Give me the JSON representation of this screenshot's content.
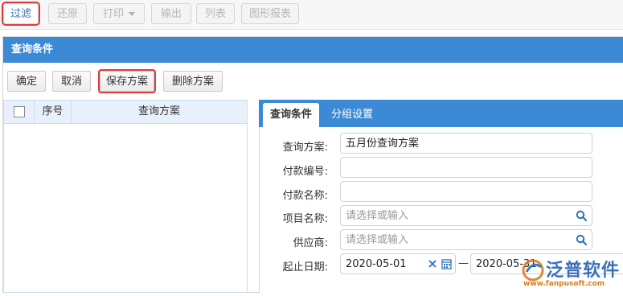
{
  "toolbar": {
    "filter": "过滤",
    "restore": "还原",
    "print": "打印",
    "export": "输出",
    "list": "列表",
    "chart_report": "图形报表"
  },
  "panel": {
    "title": "查询条件",
    "buttons": {
      "confirm": "确定",
      "cancel": "取消",
      "save_scheme": "保存方案",
      "delete_scheme": "删除方案"
    }
  },
  "grid": {
    "columns": [
      "序号",
      "查询方案"
    ]
  },
  "tabs": {
    "query": "查询条件",
    "group": "分组设置"
  },
  "form": {
    "scheme": {
      "label": "查询方案:",
      "value": "五月份查询方案"
    },
    "payment_no": {
      "label": "付款编号:",
      "value": ""
    },
    "payment_name": {
      "label": "付款名称:",
      "value": ""
    },
    "project_name": {
      "label": "项目名称:",
      "placeholder": "请选择或输入"
    },
    "supplier": {
      "label": "供应商:",
      "placeholder": "请选择或输入"
    },
    "date_range": {
      "label": "起止日期:",
      "start": "2020-05-01",
      "separator": "—",
      "end": "2020-05-31"
    }
  },
  "watermark": {
    "brand": "泛普软件",
    "url": "www.fanpusoft.com"
  },
  "colors": {
    "header_blue": "#3c8ad6",
    "highlight_red": "#e23a3a"
  }
}
